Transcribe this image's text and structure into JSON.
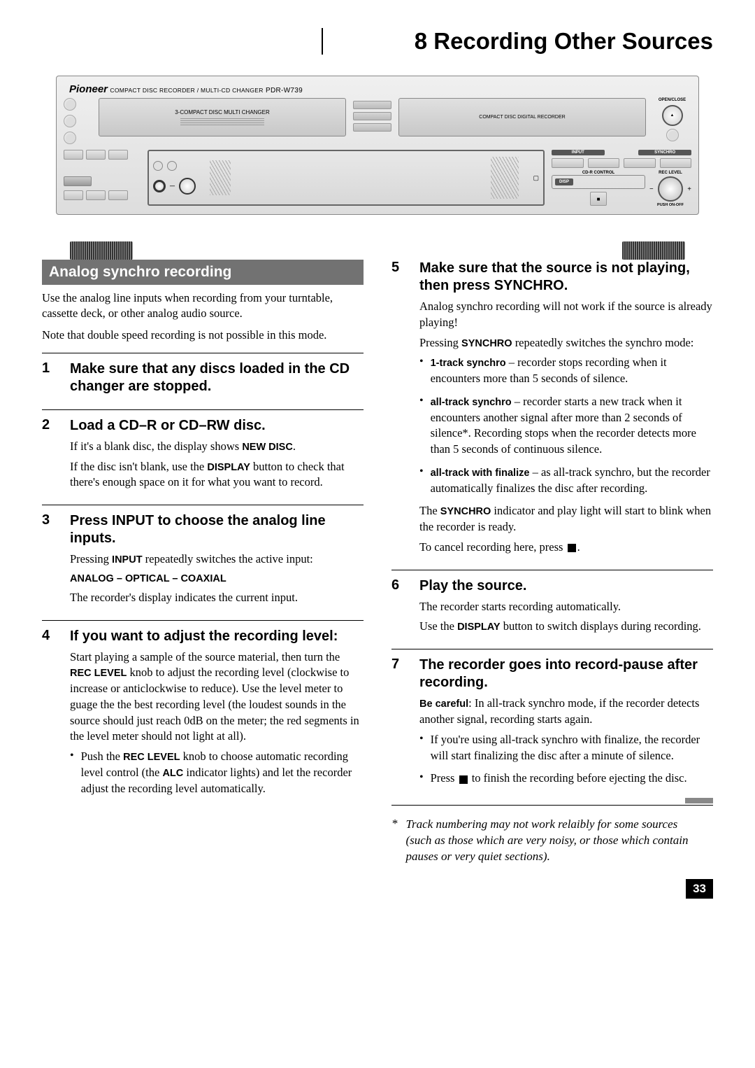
{
  "chapter": {
    "number": "8",
    "title": "Recording Other Sources"
  },
  "device": {
    "brand": "Pioneer",
    "subtitle": "COMPACT DISC RECORDER / MULTI-CD CHANGER",
    "model": "PDR-W739",
    "tray_left_label": "3-COMPACT DISC MULTI CHANGER",
    "tray_right_label": "COMPACT DISC DIGITAL RECORDER",
    "open_close": "OPEN/CLOSE",
    "input_btn": "INPUT",
    "synchro_btn": "SYNCHRO",
    "cdr_control": "CD-R CONTROL",
    "rec_level": "REC LEVEL",
    "disp": "DISP",
    "push_on_off": "PUSH ON-OFF"
  },
  "section_title": "Analog synchro recording",
  "intro1": "Use the analog line inputs when recording from your turntable, cassette deck, or other analog audio source.",
  "intro2": "Note that double speed recording is not possible in this mode.",
  "steps_left": [
    {
      "n": "1",
      "title": "Make sure that any discs loaded in the CD changer are stopped."
    },
    {
      "n": "2",
      "title": "Load a CD–R or CD–RW disc.",
      "paras": [
        {
          "pre": "If it's a blank disc, the display shows ",
          "bold": "NEW DISC",
          "post": "."
        },
        {
          "pre": "If the disc isn't blank, use the ",
          "bold": "DISPLAY",
          "post": " button to check that there's enough space on it for what you want to record."
        }
      ]
    },
    {
      "n": "3",
      "title": "Press INPUT to choose the analog line inputs.",
      "paras": [
        {
          "pre": "Pressing ",
          "bold": "INPUT",
          "post": " repeatedly switches the active input:"
        }
      ],
      "inputs_line": "ANALOG – OPTICAL – COAXIAL",
      "after": "The recorder's display indicates the current input."
    },
    {
      "n": "4",
      "title": "If you want to adjust the recording level:",
      "long": {
        "pre": "Start playing a sample of the source material, then turn the ",
        "bold": "REC LEVEL",
        "post": " knob to adjust the recording level (clockwise to increase or anticlockwise to reduce). Use the level meter to guage the the best recording level (the loudest sounds in the source should just reach 0dB on the meter; the red segments in the level meter  should not light at all)."
      },
      "bullet": {
        "pre": "Push the ",
        "bold1": "REC LEVEL",
        "mid": " knob to choose automatic recording level control (the ",
        "bold2": "ALC",
        "post": " indicator lights) and let the recorder adjust the recording level automatically."
      }
    }
  ],
  "steps_right": [
    {
      "n": "5",
      "title": "Make sure that the source is not playing, then press SYNCHRO.",
      "p1": "Analog synchro recording will not work if the source is already playing!",
      "p2": {
        "pre": "Pressing ",
        "bold": "SYNCHRO",
        "post": " repeatedly switches the synchro mode:"
      },
      "bullets": [
        {
          "bold": "1-track synchro",
          "text": " – recorder stops recording when it encounters more than 5 seconds of silence."
        },
        {
          "bold": "all-track synchro",
          "text": " – recorder starts a new track when it encounters another signal after more than 2 seconds of silence*. Recording stops when the recorder detects more than 5 seconds of continuous silence."
        },
        {
          "bold": "all-track with finalize",
          "text": " – as all-track synchro, but the recorder automatically finalizes the disc after recording."
        }
      ],
      "after1": {
        "pre": "The ",
        "bold": "SYNCHRO",
        "post": " indicator and play light will start to blink when the recorder is ready."
      },
      "after2_pre": "To cancel recording here, press ",
      "after2_post": "."
    },
    {
      "n": "6",
      "title": "Play the source.",
      "p1": "The recorder starts recording automatically.",
      "p2": {
        "pre": "Use the ",
        "bold": "DISPLAY",
        "post": " button to switch displays during recording."
      }
    },
    {
      "n": "7",
      "title": "The recorder goes into record-pause after recording.",
      "p1": {
        "bold": "Be careful",
        "post": ": In all-track synchro mode, if the recorder detects another signal, recording starts again."
      },
      "bullets": [
        {
          "text": "If you're using all-track synchro with finalize, the recorder will start finalizing the disc after a minute of silence."
        },
        {
          "stop_pre": "Press ",
          "stop_post": " to finish the recording before ejecting the disc."
        }
      ]
    }
  ],
  "footnote_ast": "*",
  "footnote": "Track numbering may not work relaibly for some sources (such as those which are very noisy, or those which contain pauses or very quiet sections).",
  "page_number": "33"
}
